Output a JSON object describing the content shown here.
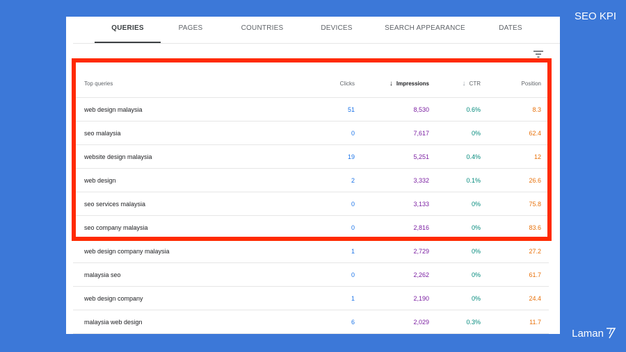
{
  "slide_title": "SEO KPI",
  "brand": "Laman",
  "tabs": [
    {
      "label": "QUERIES",
      "active": true
    },
    {
      "label": "PAGES",
      "active": false
    },
    {
      "label": "COUNTRIES",
      "active": false
    },
    {
      "label": "DEVICES",
      "active": false
    },
    {
      "label": "SEARCH APPEARANCE",
      "active": false
    },
    {
      "label": "DATES",
      "active": false
    }
  ],
  "filter_icon": "filter-icon",
  "table": {
    "headers": {
      "query": "Top queries",
      "clicks": "Clicks",
      "impressions": "Impressions",
      "ctr": "CTR",
      "position": "Position"
    },
    "sorted_by": "impressions",
    "rows": [
      {
        "query": "web design malaysia",
        "clicks": "51",
        "impressions": "8,530",
        "ctr": "0.6%",
        "position": "8.3"
      },
      {
        "query": "seo malaysia",
        "clicks": "0",
        "impressions": "7,617",
        "ctr": "0%",
        "position": "62.4"
      },
      {
        "query": "website design malaysia",
        "clicks": "19",
        "impressions": "5,251",
        "ctr": "0.4%",
        "position": "12"
      },
      {
        "query": "web design",
        "clicks": "2",
        "impressions": "3,332",
        "ctr": "0.1%",
        "position": "26.6"
      },
      {
        "query": "seo services malaysia",
        "clicks": "0",
        "impressions": "3,133",
        "ctr": "0%",
        "position": "75.8"
      },
      {
        "query": "seo company malaysia",
        "clicks": "0",
        "impressions": "2,816",
        "ctr": "0%",
        "position": "83.6"
      },
      {
        "query": "web design company malaysia",
        "clicks": "1",
        "impressions": "2,729",
        "ctr": "0%",
        "position": "27.2"
      },
      {
        "query": "malaysia seo",
        "clicks": "0",
        "impressions": "2,262",
        "ctr": "0%",
        "position": "61.7"
      },
      {
        "query": "web design company",
        "clicks": "1",
        "impressions": "2,190",
        "ctr": "0%",
        "position": "24.4"
      },
      {
        "query": "malaysia web design",
        "clicks": "6",
        "impressions": "2,029",
        "ctr": "0.3%",
        "position": "11.7"
      }
    ]
  },
  "colors": {
    "background": "#3c78d8",
    "highlight": "#ff2a00",
    "clicks": "#1a73e8",
    "impressions": "#7b1fa2",
    "ctr": "#00897b",
    "position": "#e8710a"
  }
}
